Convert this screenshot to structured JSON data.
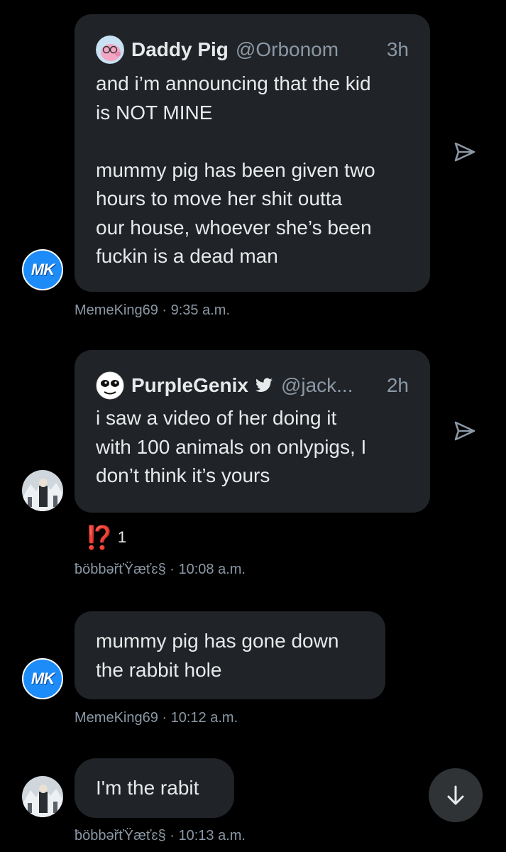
{
  "messages": [
    {
      "quote": {
        "name": "Daddy Pig",
        "handle": "@Orbonom",
        "time": "3h",
        "text": "and i’m announcing that the kid\nis NOT MINE\n\nmummy pig has been given two\nhours to move her shit outta\nour house, whoever she’s been\nfuckin is a dead man"
      },
      "sender": "MemeKing69",
      "time": "9:35 a.m.",
      "avatar_initials": "MK"
    },
    {
      "quote": {
        "name": "PurpleGenix",
        "handle": "@jack...",
        "time": "2h",
        "text": "i saw a video of her doing it\nwith 100 animals on onlypigs, I\ndon’t think it’s yours"
      },
      "reaction": {
        "emoji": "⁉️",
        "count": "1"
      },
      "sender": "ƀöbbəřťŸæťɛ§",
      "time": "10:08 a.m."
    },
    {
      "text": "mummy pig has gone down\nthe rabbit hole",
      "sender": "MemeKing69",
      "time": "10:12 a.m.",
      "avatar_initials": "MK"
    },
    {
      "text": "I'm the rabit",
      "sender": "ƀöbbəřťŸæťɛ§",
      "time": "10:13 a.m."
    }
  ],
  "icons": {
    "share": "share-icon",
    "verified": "bird-badge-icon",
    "scroll_down": "arrow-down-icon"
  },
  "colors": {
    "background": "#000000",
    "bubble": "#202327",
    "muted": "#8b98a5",
    "mk_avatar": "#1d8cf8",
    "reaction": "#f4212e"
  }
}
